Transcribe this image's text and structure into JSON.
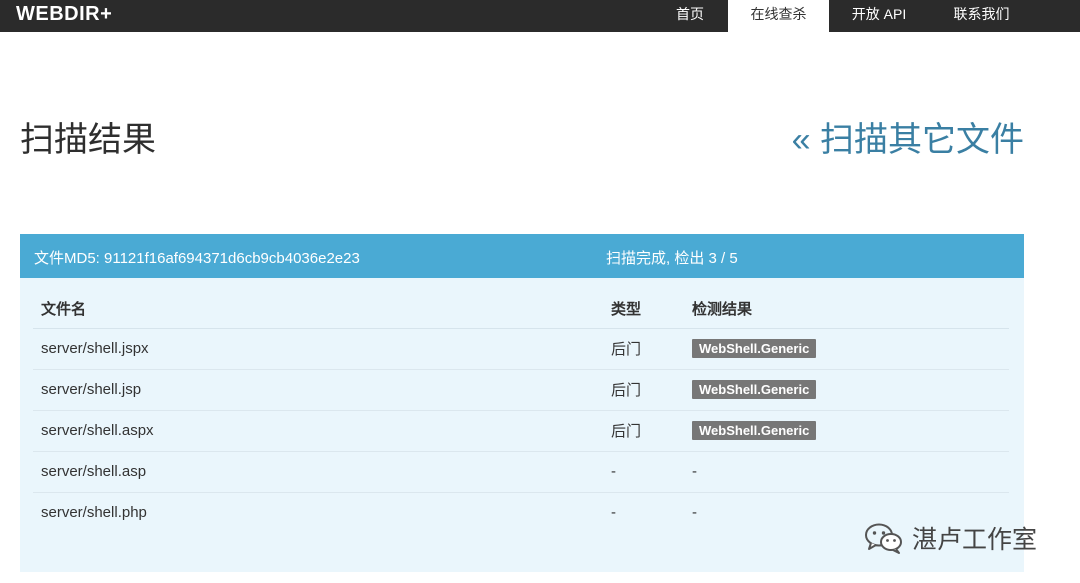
{
  "navbar": {
    "brand": "WEBDIR+",
    "items": [
      {
        "label": "首页",
        "active": false
      },
      {
        "label": "在线查杀",
        "active": true
      },
      {
        "label": "开放 API",
        "active": false
      },
      {
        "label": "联系我们",
        "active": false
      }
    ]
  },
  "header": {
    "title": "扫描结果",
    "back_link": "« 扫描其它文件"
  },
  "panel": {
    "md5_text": "文件MD5: 91121f16af694371d6cb9cb4036e2e23",
    "status_text": "扫描完成, 检出 3 / 5",
    "color": "#4aaad4"
  },
  "table": {
    "headers": [
      "文件名",
      "类型",
      "检测结果"
    ],
    "rows": [
      {
        "file": "server/shell.jspx",
        "type": "后门",
        "result": "WebShell.Generic"
      },
      {
        "file": "server/shell.jsp",
        "type": "后门",
        "result": "WebShell.Generic"
      },
      {
        "file": "server/shell.aspx",
        "type": "后门",
        "result": "WebShell.Generic"
      },
      {
        "file": "server/shell.asp",
        "type": "-",
        "result": "-"
      },
      {
        "file": "server/shell.php",
        "type": "-",
        "result": "-"
      }
    ]
  },
  "watermark": {
    "text": "湛卢工作室",
    "icon": "wechat-icon"
  }
}
